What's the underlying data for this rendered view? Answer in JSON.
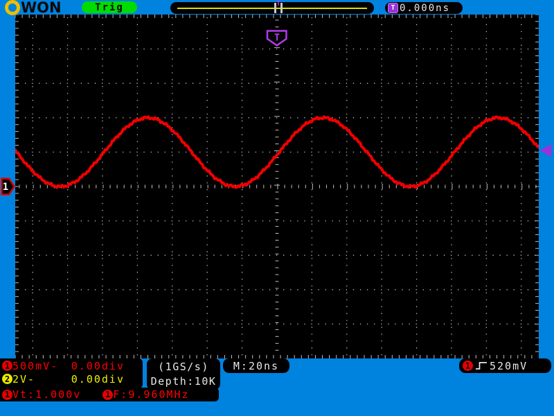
{
  "colors": {
    "background": "#0082DF",
    "screen": "#000000",
    "trace_red": "#F00000",
    "channel2_yellow": "#F0F000",
    "trig_green": "#00DC00",
    "purple": "#A832E0",
    "grid_tick": "#C0C0C0",
    "hpos_line_yellow": "#DCDC00",
    "logo_gold": "#EDBE00"
  },
  "header": {
    "brand_rest": "WON",
    "trig_status": "Trig",
    "trigger_time_icon": "T",
    "trigger_time": "0.000ns",
    "hpos_marker": "T"
  },
  "scope": {
    "trigger_position_marker": "T",
    "ch1_marker": "1"
  },
  "footer": {
    "ch1": {
      "num": "1",
      "scale": "500mV-",
      "offset": "0.00div"
    },
    "ch2": {
      "num": "2",
      "scale": "2V-",
      "offset": "0.00div"
    },
    "acquisition": {
      "sample_rate": "(1GS/s)",
      "depth": "Depth:10K"
    },
    "timebase": "M:20ns",
    "measure": {
      "ch1_num": "1",
      "vt": "Vt:1.000v",
      "ch1_num2": "1",
      "freq": "F:9.960MHz"
    },
    "trigger": {
      "ch_num": "1",
      "edge": "rising",
      "level": "520mV"
    }
  },
  "chart_data": {
    "type": "line",
    "title": "CH1 oscilloscope trace",
    "x_unit": "ns",
    "y_unit": "V",
    "time_per_div_ns": 20,
    "volts_per_div": 0.5,
    "h_divisions": 15,
    "v_divisions": 10,
    "x_range_ns": [
      -151,
      151
    ],
    "trigger_time_ns": 0,
    "trigger_level_v": 0.52,
    "ch1_zero_div": 0.0,
    "signal": {
      "shape": "sine",
      "frequency_mhz": 9.96,
      "amplitude_v": 0.5,
      "offset_v": 0.5,
      "peak_time_ns": -74,
      "measured_vt_v": 1.0,
      "measured_freq_mhz": 9.96
    },
    "trace_color": "#F00000",
    "grid": {
      "style": "dots",
      "legend": false
    }
  }
}
